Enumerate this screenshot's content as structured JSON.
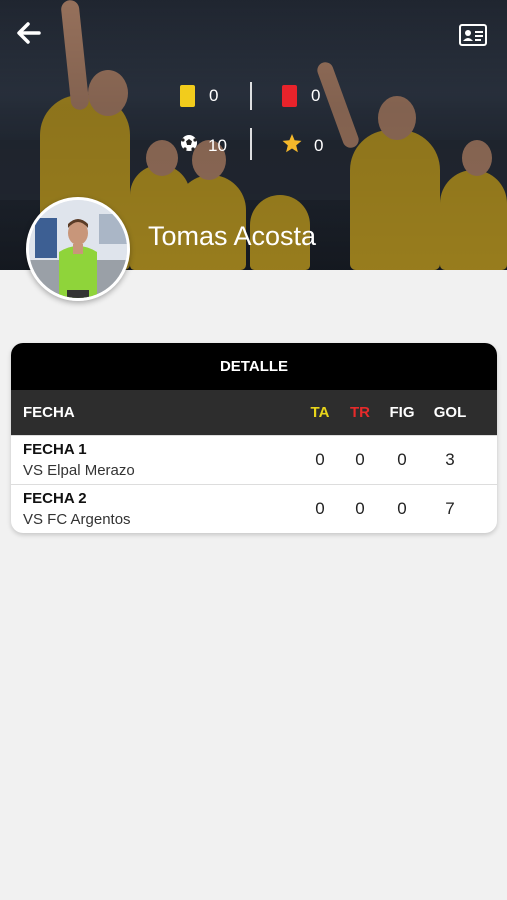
{
  "header": {
    "back_icon": "arrow-left-icon",
    "profile_card_icon": "id-card-icon"
  },
  "stats": {
    "yellow_cards": "0",
    "red_cards": "0",
    "goals": "10",
    "stars": "0"
  },
  "player": {
    "name": "Tomas Acosta"
  },
  "detail": {
    "title": "DETALLE",
    "columns": {
      "fecha": "FECHA",
      "ta": "TA",
      "tr": "TR",
      "fig": "FIG",
      "gol": "GOL"
    },
    "rows": [
      {
        "fecha": "FECHA 1",
        "rival": "VS Elpal Merazo",
        "ta": "0",
        "tr": "0",
        "fig": "0",
        "gol": "3"
      },
      {
        "fecha": "FECHA 2",
        "rival": "VS FC Argentos",
        "ta": "0",
        "tr": "0",
        "fig": "0",
        "gol": "7"
      }
    ]
  },
  "colors": {
    "yellow_card": "#f2cc1c",
    "red_card": "#e8232b",
    "table_header": "#2d2d2d",
    "title_bar": "#000000"
  }
}
